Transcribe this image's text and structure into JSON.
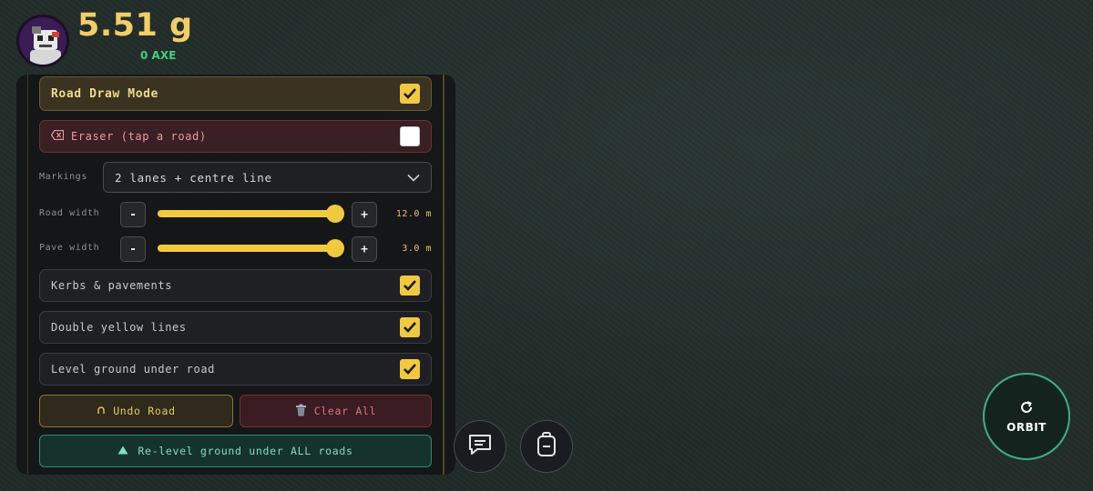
{
  "hud": {
    "balance": "5.51 g",
    "token": "0 AXE"
  },
  "panel": {
    "road_draw_mode": {
      "label": "Road Draw Mode",
      "checked": true
    },
    "eraser": {
      "icon": "backspace-icon",
      "label": "Eraser (tap a road)",
      "checked": false
    },
    "markings": {
      "label": "Markings",
      "value": "2 lanes + centre line"
    },
    "road_width": {
      "label": "Road width",
      "minus": "-",
      "plus": "+",
      "value_text": "12.0 m",
      "level": 1.0
    },
    "pave_width": {
      "label": "Pave width",
      "minus": "-",
      "plus": "+",
      "value_text": "3.0 m",
      "level": 1.0
    },
    "kerbs": {
      "label": "Kerbs & pavements",
      "checked": true
    },
    "double_yellow": {
      "label": "Double yellow lines",
      "checked": true
    },
    "level_ground": {
      "label": "Level ground under road",
      "checked": true
    },
    "undo": {
      "icon": "undo-icon",
      "label": "Undo Road"
    },
    "clear": {
      "icon": "trash-icon",
      "label": "Clear All"
    },
    "relevel": {
      "icon": "triangle-up-icon",
      "label": "Re-level ground under ALL roads"
    }
  },
  "controls": {
    "chat": {
      "icon": "chat-icon"
    },
    "backpack": {
      "icon": "backpack-icon"
    },
    "orbit": {
      "icon": "rotate-icon",
      "label": "ORBIT"
    }
  },
  "colors": {
    "accent_yellow": "#f1c93f",
    "balance_gold": "#f3cd66",
    "token_green": "#3fd07f",
    "orbit_teal": "#3fae8a"
  }
}
